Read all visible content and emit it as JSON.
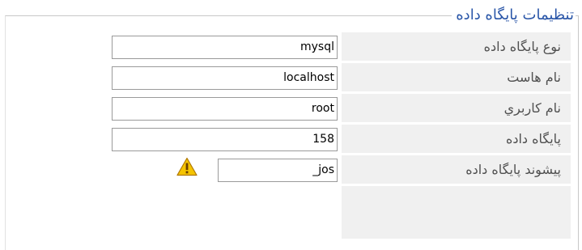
{
  "section": {
    "title": "تنظيمات پايگاه داده"
  },
  "fields": [
    {
      "label": "نوع پايگاه داده",
      "value": "mysql"
    },
    {
      "label": "نام هاست",
      "value": "localhost"
    },
    {
      "label": "نام کاربري",
      "value": "root"
    },
    {
      "label": "پايگاه داده",
      "value": "158"
    },
    {
      "label": "پيشوند پايگاه داده",
      "value": "_jos"
    }
  ],
  "icons": {
    "prefix_warning": "warning-icon"
  },
  "colors": {
    "title": "#2a56a8",
    "label_bg": "#f0f0f0",
    "label_text": "#505050",
    "warning_fill": "#f5c400"
  }
}
